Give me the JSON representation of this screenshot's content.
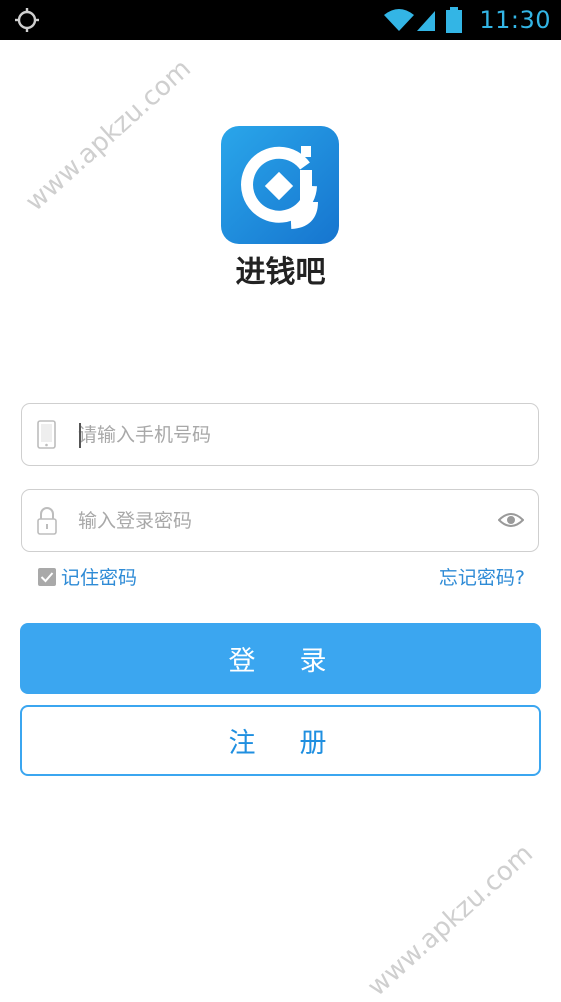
{
  "status_bar": {
    "time": "11:30",
    "left_icon": "gps-crosshair-icon",
    "icons": [
      "wifi-icon",
      "signal-icon",
      "battery-icon"
    ]
  },
  "watermark": {
    "text": "www.apkzu.com"
  },
  "app": {
    "name": "进钱吧",
    "logo_icon": "app-logo-icon"
  },
  "login_form": {
    "phone_placeholder": "请输入手机号码",
    "phone_value": "",
    "password_placeholder": "输入登录密码",
    "password_value": "",
    "remember_label": "记住密码",
    "remember_checked": true,
    "forgot_label": "忘记密码?",
    "login_button": "登录",
    "register_button": "注册"
  },
  "colors": {
    "accent": "#3ba6f0",
    "link": "#2e8bd6",
    "logo_gradient_start": "#2aa6ea",
    "logo_gradient_end": "#1675cf",
    "status_icon": "#33b5e5"
  }
}
